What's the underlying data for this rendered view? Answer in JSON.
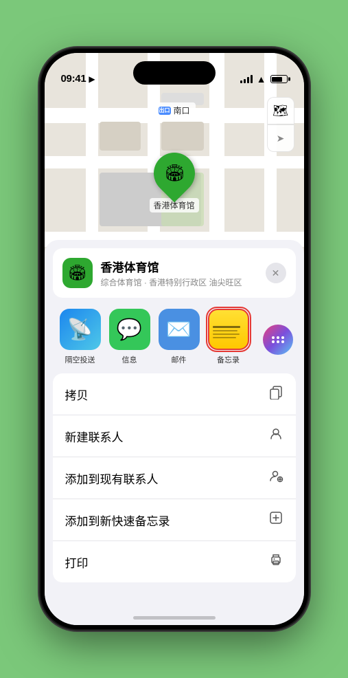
{
  "status_bar": {
    "time": "09:41",
    "location_arrow": "▶"
  },
  "map": {
    "label_prefix": "南口",
    "pin_emoji": "🏟",
    "venue_map_label": "香港体育馆"
  },
  "venue": {
    "name": "香港体育馆",
    "description": "综合体育馆 · 香港特别行政区 油尖旺区",
    "icon_emoji": "🏟"
  },
  "share_items": [
    {
      "id": "airdrop",
      "label": "隔空投送",
      "emoji": "📡"
    },
    {
      "id": "messages",
      "label": "信息",
      "emoji": "💬"
    },
    {
      "id": "mail",
      "label": "邮件",
      "emoji": "✉️"
    },
    {
      "id": "notes",
      "label": "备忘录",
      "emoji": ""
    }
  ],
  "action_items": [
    {
      "id": "copy",
      "label": "拷贝",
      "icon": "⎘"
    },
    {
      "id": "new-contact",
      "label": "新建联系人",
      "icon": "👤"
    },
    {
      "id": "add-existing",
      "label": "添加到现有联系人",
      "icon": "👤"
    },
    {
      "id": "add-notes",
      "label": "添加到新快速备忘录",
      "icon": "⊞"
    },
    {
      "id": "print",
      "label": "打印",
      "icon": "🖨"
    }
  ],
  "buttons": {
    "close_label": "✕",
    "map_icon": "🗺",
    "compass_icon": "➤"
  }
}
